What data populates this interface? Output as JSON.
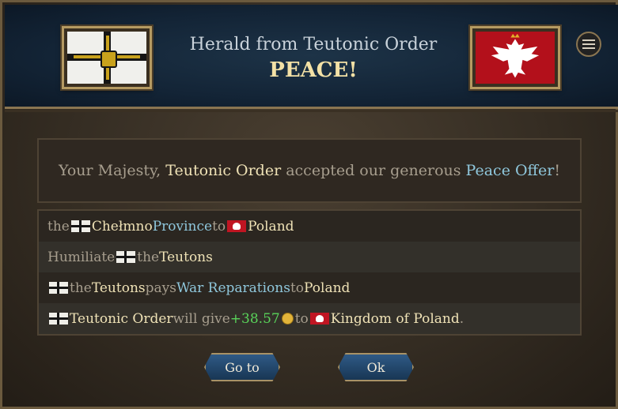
{
  "header": {
    "herald_title": "Herald from Teutonic Order",
    "headline": "PEACE!",
    "left_flag": "teutonic-order-flag",
    "right_flag": "poland-flag"
  },
  "message": {
    "prefix": "Your Majesty, ",
    "actor": "Teutonic Order",
    "middle": " accepted our generous ",
    "offer": "Peace Offer",
    "suffix": "!"
  },
  "terms": [
    {
      "pre": "the ",
      "place": "Chełmno",
      "mid": " ",
      "link": "Province",
      "to": " to ",
      "target": "Poland"
    },
    {
      "pre": "Humiliate ",
      "mid": " the ",
      "target": "Teutons"
    },
    {
      "mid": " the ",
      "actor": "Teutons",
      "verb": " pays ",
      "link": "War Reparations",
      "to": " to ",
      "target": "Poland"
    },
    {
      "actor": "Teutonic Order",
      "verb": " will give ",
      "amount": "+38.57",
      "to": " to ",
      "target": "Kingdom of Poland",
      "suffix": "."
    }
  ],
  "buttons": {
    "goto": "Go to",
    "ok": "Ok"
  },
  "colors": {
    "highlight": "#efe2b6",
    "link": "#8fc7dc",
    "positive": "#59d35a",
    "header_bg": "#132436"
  }
}
